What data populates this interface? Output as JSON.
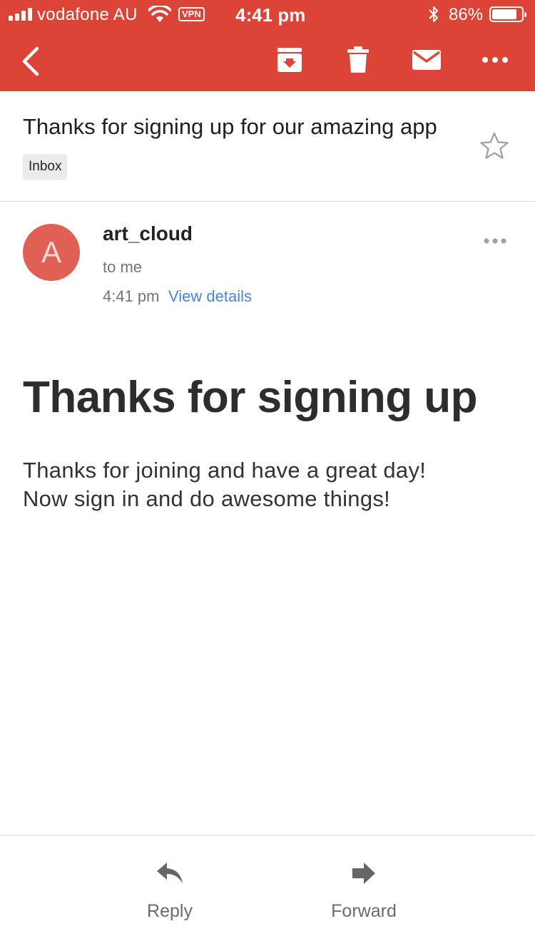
{
  "status_bar": {
    "carrier": "vodafone AU",
    "vpn": "VPN",
    "time": "4:41 pm",
    "battery_percent": "86%",
    "battery_level": 0.86,
    "signal_bars": 4
  },
  "toolbar": {
    "icons": [
      "back-icon",
      "archive-icon",
      "trash-icon",
      "mail-icon",
      "more-icon"
    ]
  },
  "email": {
    "subject": "Thanks for signing up for our amazing app",
    "label": "Inbox",
    "starred": false,
    "sender": "art_cloud",
    "avatar_letter": "A",
    "recipient": "to me",
    "time": "4:41 pm",
    "view_details": "View details",
    "headline": "Thanks for signing up",
    "body_lines": [
      "Thanks for joining and have a great day!",
      "Now sign in and do awesome things!"
    ]
  },
  "actions": {
    "reply": "Reply",
    "forward": "Forward"
  },
  "colors": {
    "brand": "#db4437",
    "avatar": "#e06055",
    "link": "#4a86d9"
  }
}
